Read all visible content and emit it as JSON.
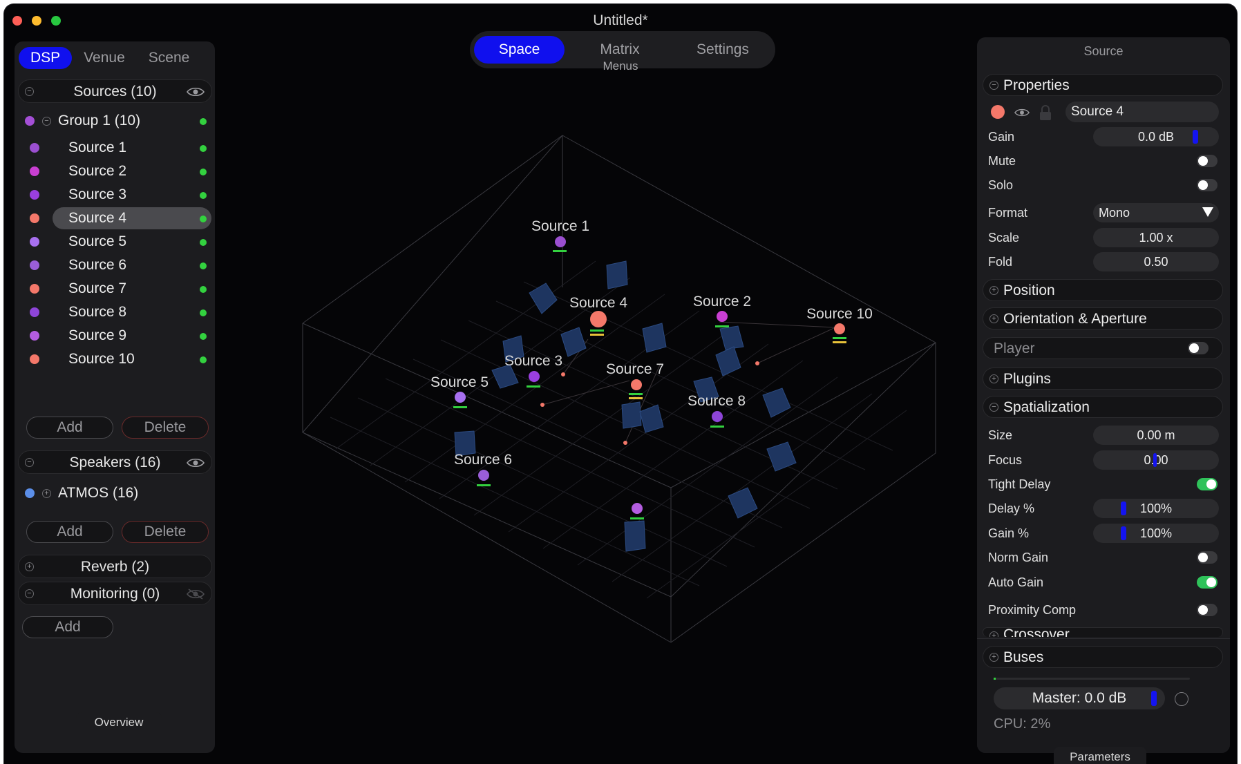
{
  "window": {
    "title": "Untitled*"
  },
  "left": {
    "tabs": [
      "DSP",
      "Venue",
      "Scene"
    ],
    "sources_header": "Sources (10)",
    "group": {
      "label": "Group 1 (10)",
      "color": "#a44fd6"
    },
    "sources": [
      {
        "label": "Source 1",
        "color": "#9b4fd0"
      },
      {
        "label": "Source 2",
        "color": "#c93fd2"
      },
      {
        "label": "Source 3",
        "color": "#9a3fe0"
      },
      {
        "label": "Source 4",
        "color": "#f4786a"
      },
      {
        "label": "Source 5",
        "color": "#a870f0"
      },
      {
        "label": "Source 6",
        "color": "#9a5ed8"
      },
      {
        "label": "Source 7",
        "color": "#f4786a"
      },
      {
        "label": "Source 8",
        "color": "#8e45d8"
      },
      {
        "label": "Source 9",
        "color": "#b45de0"
      },
      {
        "label": "Source 10",
        "color": "#f4786a"
      }
    ],
    "add_label": "Add",
    "delete_label": "Delete",
    "speakers_header": "Speakers (16)",
    "atmos": {
      "label": "ATMOS (16)",
      "color": "#5b8ee8"
    },
    "reverb_header": "Reverb (2)",
    "monitoring_header": "Monitoring (0)",
    "caption": "Overview"
  },
  "top_tabs": {
    "tabs": [
      "Space",
      "Matrix",
      "Settings"
    ],
    "active": "Space",
    "caption": "Menus"
  },
  "right": {
    "title": "Source",
    "properties_header": "Properties",
    "source_name": "Source 4",
    "source_color": "#f4786a",
    "gain": {
      "label": "Gain",
      "value": "0.0 dB"
    },
    "mute": {
      "label": "Mute",
      "on": false
    },
    "solo": {
      "label": "Solo",
      "on": false
    },
    "format": {
      "label": "Format",
      "value": "Mono"
    },
    "scale": {
      "label": "Scale",
      "value": "1.00 x"
    },
    "fold": {
      "label": "Fold",
      "value": "0.50"
    },
    "position_header": "Position",
    "orientation_header": "Orientation & Aperture",
    "player_header": "Player",
    "plugins_header": "Plugins",
    "spatialization_header": "Spatialization",
    "size": {
      "label": "Size",
      "value": "0.00 m"
    },
    "focus": {
      "label": "Focus",
      "value": "0.00"
    },
    "tight_delay": {
      "label": "Tight Delay",
      "on": true
    },
    "delay_pct": {
      "label": "Delay %",
      "value": "100%"
    },
    "gain_pct": {
      "label": "Gain %",
      "value": "100%"
    },
    "norm_gain": {
      "label": "Norm Gain",
      "on": false
    },
    "auto_gain": {
      "label": "Auto Gain",
      "on": true
    },
    "proximity_comp": {
      "label": "Proximity Comp",
      "on": false
    },
    "crossover_header": "Crossover",
    "buses_header": "Buses",
    "master": "Master: 0.0 dB",
    "cpu": "CPU: 2%",
    "caption": "Parameters"
  },
  "scene": {
    "labels": [
      "Source 1",
      "Source 4",
      "Source 2",
      "Source 10",
      "Source 3",
      "Source 7",
      "Source 5",
      "Source 8",
      "Source 6"
    ]
  }
}
